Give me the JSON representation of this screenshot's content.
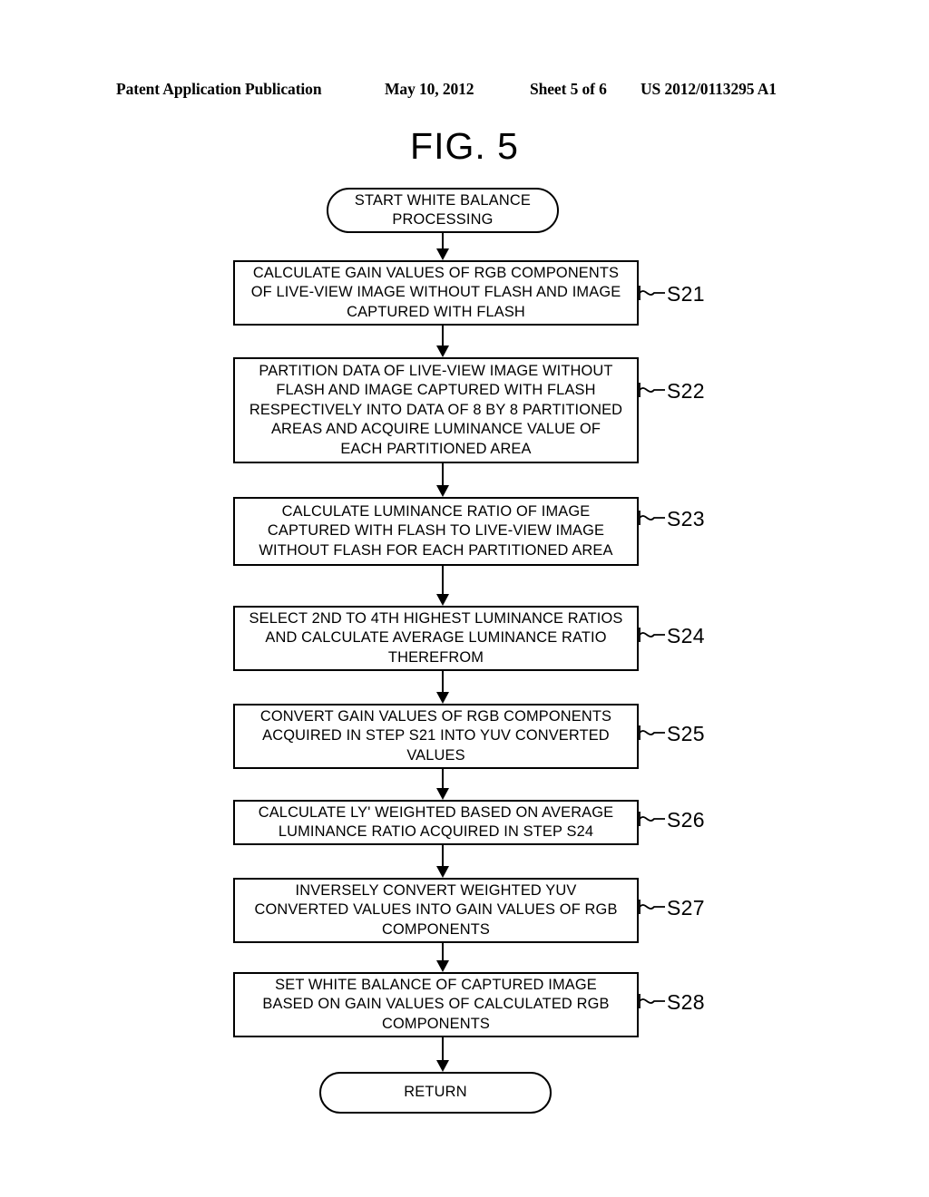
{
  "header": {
    "publication": "Patent Application Publication",
    "date": "May 10, 2012",
    "sheet": "Sheet 5 of 6",
    "patent_number": "US 2012/0113295 A1"
  },
  "figure": {
    "title": "FIG. 5"
  },
  "flowchart": {
    "nodes": [
      {
        "id": "start",
        "type": "terminator",
        "text": "START WHITE BALANCE\nPROCESSING",
        "step": null
      },
      {
        "id": "s21",
        "type": "process",
        "text": "CALCULATE GAIN VALUES OF RGB COMPONENTS\nOF LIVE-VIEW IMAGE WITHOUT FLASH AND IMAGE\nCAPTURED WITH FLASH",
        "step": "S21"
      },
      {
        "id": "s22",
        "type": "process",
        "text": "PARTITION DATA OF LIVE-VIEW IMAGE WITHOUT\nFLASH AND IMAGE CAPTURED WITH FLASH\nRESPECTIVELY INTO DATA OF 8 BY 8 PARTITIONED\nAREAS AND ACQUIRE LUMINANCE VALUE OF\nEACH PARTITIONED AREA",
        "step": "S22"
      },
      {
        "id": "s23",
        "type": "process",
        "text": "CALCULATE LUMINANCE RATIO OF IMAGE\nCAPTURED WITH FLASH  TO LIVE-VIEW IMAGE\nWITHOUT FLASH FOR EACH PARTITIONED AREA",
        "step": "S23"
      },
      {
        "id": "s24",
        "type": "process",
        "text": "SELECT 2ND TO 4TH HIGHEST LUMINANCE RATIOS\nAND CALCULATE AVERAGE LUMINANCE RATIO\nTHEREFROM",
        "step": "S24"
      },
      {
        "id": "s25",
        "type": "process",
        "text": "CONVERT GAIN VALUES OF RGB COMPONENTS\nACQUIRED IN STEP S21 INTO YUV CONVERTED\nVALUES",
        "step": "S25"
      },
      {
        "id": "s26",
        "type": "process",
        "text": "CALCULATE LY' WEIGHTED BASED ON AVERAGE\nLUMINANCE RATIO ACQUIRED IN STEP S24",
        "step": "S26"
      },
      {
        "id": "s27",
        "type": "process",
        "text": "INVERSELY CONVERT WEIGHTED YUV\nCONVERTED VALUES INTO GAIN VALUES OF RGB\nCOMPONENTS",
        "step": "S27"
      },
      {
        "id": "s28",
        "type": "process",
        "text": "SET WHITE BALANCE OF CAPTURED IMAGE\nBASED ON GAIN VALUES OF CALCULATED RGB\nCOMPONENTS",
        "step": "S28"
      },
      {
        "id": "return",
        "type": "terminator",
        "text": "RETURN",
        "step": null
      }
    ]
  }
}
